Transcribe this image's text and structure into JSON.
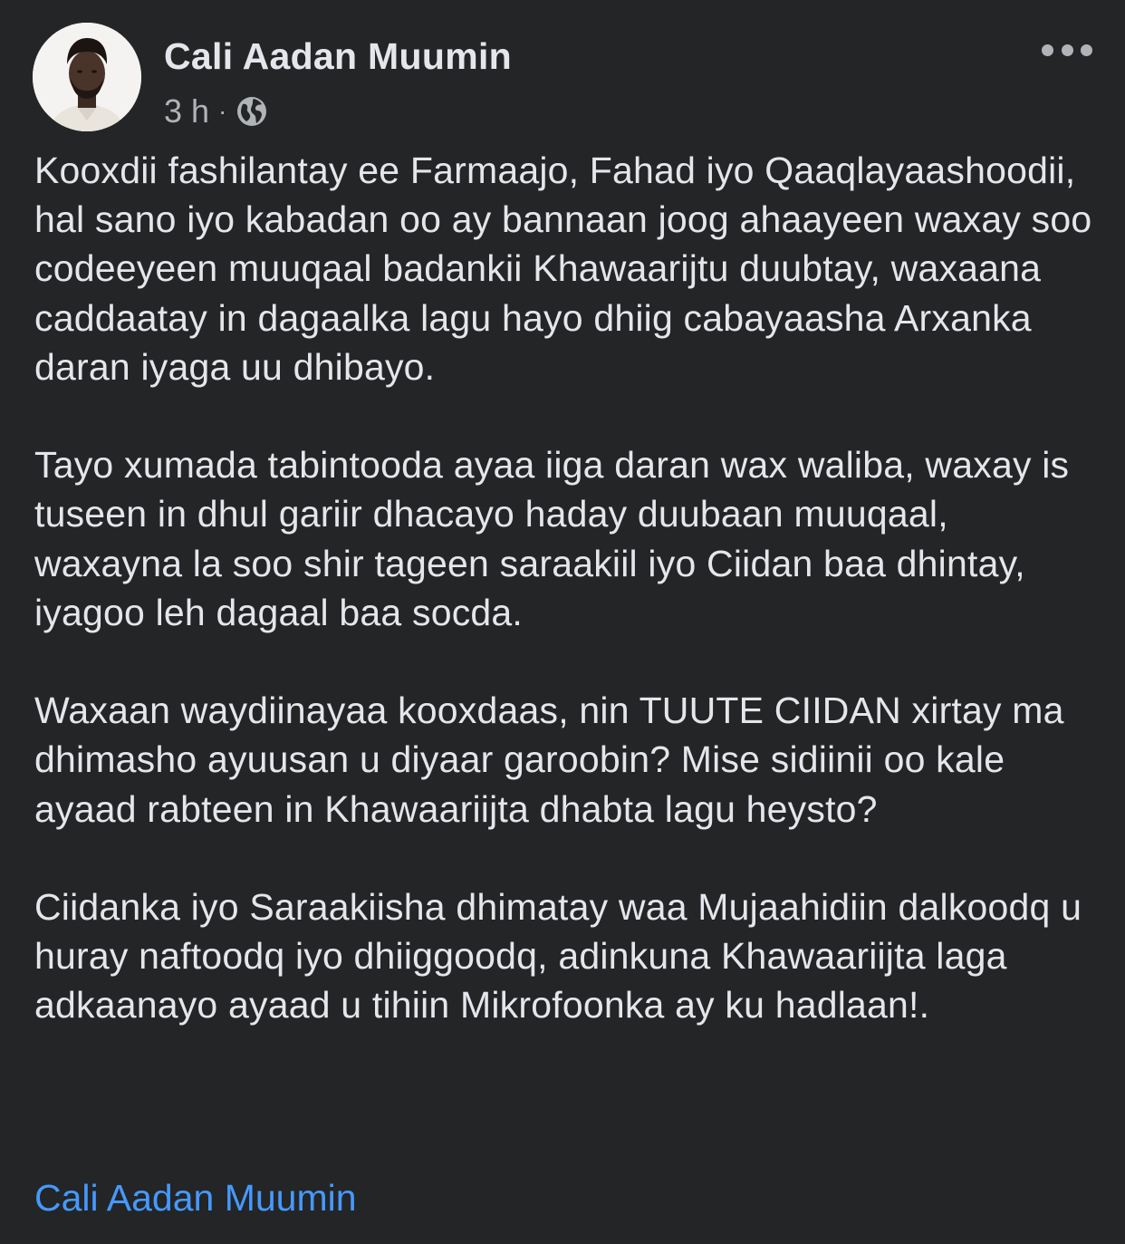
{
  "post": {
    "author": "Cali Aadan Muumin",
    "timestamp": "3 h",
    "separator": "·",
    "audience_icon": "globe-icon",
    "more_icon": "more-options-icon",
    "paragraphs": [
      "Kooxdii fashilantay ee Farmaajo, Fahad iyo Qaaqlayaashoodii, hal sano iyo kabadan oo ay bannaan joog ahaayeen waxay soo codeeyeen muuqaal badankii Khawaarijtu duubtay, waxaana caddaatay in dagaalka lagu hayo dhiig cabayaasha Arxanka daran iyaga uu dhibayo.",
      "Tayo xumada tabintooda ayaa iiga daran wax waliba, waxay is tuseen in dhul gariir dhacayo haday duubaan muuqaal, waxayna la soo shir tageen saraakiil iyo Ciidan baa dhintay, iyagoo leh dagaal baa socda.",
      "Waxaan waydiinayaa kooxdaas, nin TUUTE CIIDAN xirtay ma dhimasho ayuusan u diyaar garoobin? Mise sidiinii oo kale ayaad rabteen in Khawaariijta dhabta lagu heysto?",
      "Ciidanka iyo Saraakiisha dhimatay waa Mujaahidiin dalkoodq u huray naftoodq iyo dhiiggoodq, adinkuna Khawaariijta laga adkaanayo ayaad u tihiin Mikrofoonka ay ku hadlaan!."
    ],
    "mention_link": "Cali Aadan Muumin"
  },
  "colors": {
    "background": "#242526",
    "primary_text": "#e4e6eb",
    "secondary_text": "#b0b3b8",
    "link": "#4599ff"
  }
}
